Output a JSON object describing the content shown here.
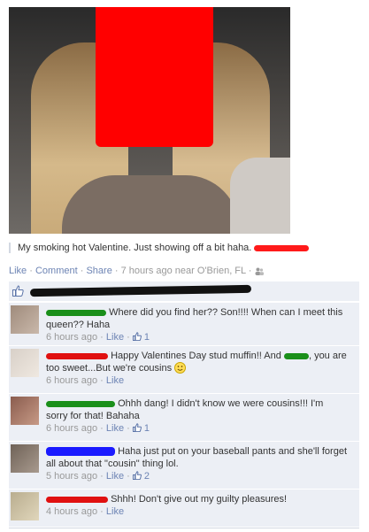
{
  "post": {
    "caption": "My smoking hot Valentine. Just showing off a bit haha.",
    "like_label": "Like",
    "comment_label": "Comment",
    "share_label": "Share",
    "timestamp": "7 hours ago near O'Brien, FL",
    "separator": "·"
  },
  "comments": [
    {
      "text": "Where did you find her?? Son!!!! When can I meet this queen?? Haha",
      "time": "6 hours ago",
      "like_label": "Like",
      "likes": "1"
    },
    {
      "text_a": "Happy Valentines Day stud muffin!! And",
      "text_b": ", you are too sweet...But we're cousins",
      "time": "6 hours ago",
      "like_label": "Like"
    },
    {
      "text": "Ohhh dang! I didn't know we were cousins!!! I'm sorry for that! Bahaha",
      "time": "6 hours ago",
      "like_label": "Like",
      "likes": "1"
    },
    {
      "text": "Haha just put on your baseball pants and she'll forget all about that \"cousin\" thing lol.",
      "time": "5 hours ago",
      "like_label": "Like",
      "likes": "2"
    },
    {
      "text": "Shhh! Don't give out my guilty pleasures!",
      "time": "4 hours ago",
      "like_label": "Like"
    }
  ],
  "colors": {
    "link": "#6d84b4",
    "panel": "#eceff5",
    "redaction_red": "#ff0000",
    "redaction_green": "#1a8f1a",
    "redaction_blue": "#1a1aff"
  }
}
